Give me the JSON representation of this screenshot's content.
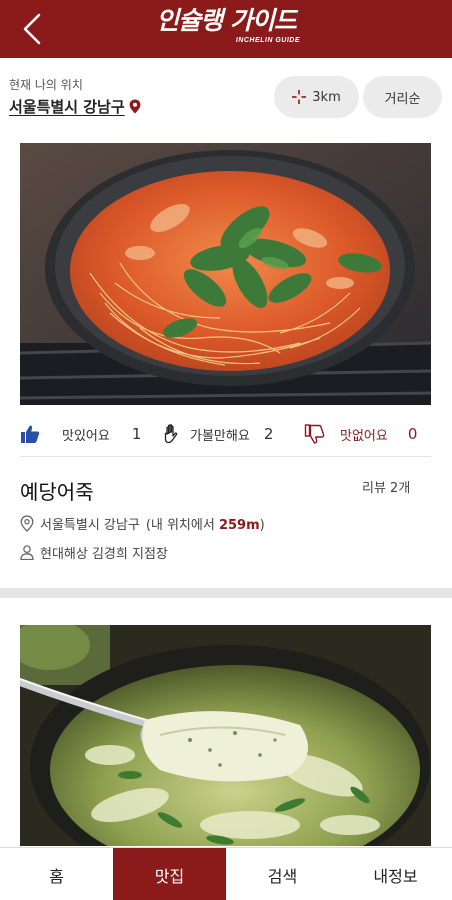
{
  "header": {
    "logo_text": "인슐랭 가이드",
    "logo_subtext": "INCHELIN GUIDE"
  },
  "location": {
    "caption": "현재 나의 위치",
    "name": "서울특별시 강남구"
  },
  "filters": {
    "distance": "3km",
    "sort": "거리순"
  },
  "cards": [
    {
      "reactions": {
        "like_label": "맛있어요",
        "like_count": "1",
        "ok_label": "가볼만해요",
        "ok_count": "2",
        "bad_label": "맛없어요",
        "bad_count": "0"
      },
      "name": "예당어죽",
      "review_count": "리뷰 2개",
      "address": "서울특별시 강남구",
      "distance_prefix": "(내 위치에서",
      "distance": "259m",
      "distance_suffix": ")",
      "host": "현대해상 김경희 지점장"
    }
  ],
  "bottom_nav": {
    "items": [
      "홈",
      "맛집",
      "검색",
      "내정보"
    ],
    "active": "맛집"
  },
  "colors": {
    "brand": "#8b1a1a",
    "pill_bg": "#ebebeb",
    "like_icon": "#2a4fa8"
  }
}
